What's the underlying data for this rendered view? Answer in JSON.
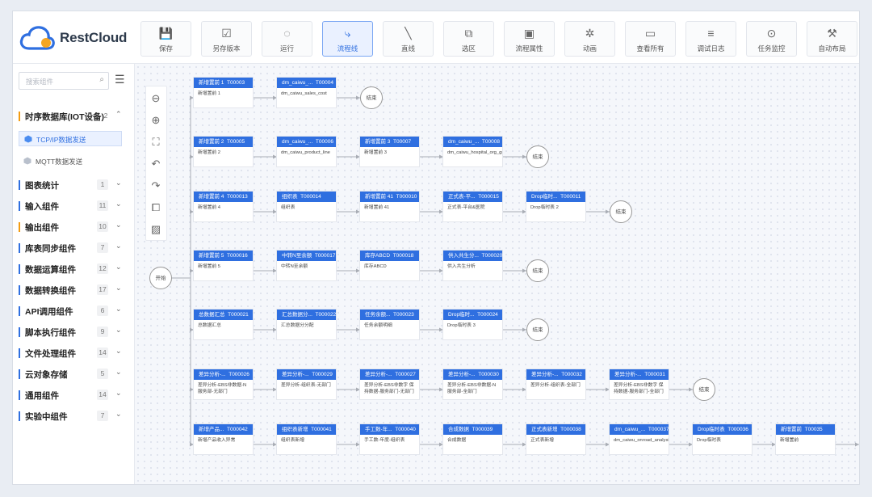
{
  "app": {
    "logo_text": "RestCloud"
  },
  "toolbar": [
    {
      "label": "保存",
      "icon": "💾"
    },
    {
      "label": "另存版本",
      "icon": "☑"
    },
    {
      "label": "运行",
      "icon": "◌"
    },
    {
      "label": "流程线",
      "icon": "⤷",
      "active": true
    },
    {
      "label": "直线",
      "icon": "╲"
    },
    {
      "label": "选区",
      "icon": "⧉"
    },
    {
      "label": "流程属性",
      "icon": "▣"
    },
    {
      "label": "动画",
      "icon": "✲"
    },
    {
      "label": "查看所有",
      "icon": "▭"
    },
    {
      "label": "调试日志",
      "icon": "≡"
    },
    {
      "label": "任务监控",
      "icon": "⊙"
    },
    {
      "label": "自动布局",
      "icon": "⚒"
    }
  ],
  "sidebar": {
    "search_placeholder": "搜索组件",
    "groups": [
      {
        "label": "时序数据库(IOT设备)",
        "count": "2",
        "chev": "⌃",
        "warn": true
      },
      {
        "label": "图表统计",
        "count": "1",
        "chev": "⌄"
      },
      {
        "label": "输入组件",
        "count": "11",
        "chev": "⌄"
      },
      {
        "label": "输出组件",
        "count": "10",
        "chev": "⌄",
        "warn": true
      },
      {
        "label": "库表同步组件",
        "count": "7",
        "chev": "⌄"
      },
      {
        "label": "数据运算组件",
        "count": "12",
        "chev": "⌄"
      },
      {
        "label": "数据转换组件",
        "count": "17",
        "chev": "⌄"
      },
      {
        "label": "API调用组件",
        "count": "6",
        "chev": "⌄"
      },
      {
        "label": "脚本执行组件",
        "count": "9",
        "chev": "⌄"
      },
      {
        "label": "文件处理组件",
        "count": "14",
        "chev": "⌄"
      },
      {
        "label": "云对象存储",
        "count": "5",
        "chev": "⌄"
      },
      {
        "label": "通用组件",
        "count": "14",
        "chev": "⌄"
      },
      {
        "label": "实验中组件",
        "count": "7",
        "chev": "⌄"
      }
    ],
    "sub_items": [
      {
        "label": "TCP/IP数据发送",
        "active": true
      },
      {
        "label": "MQTT数据发送",
        "active": false
      }
    ]
  },
  "canvas_tools": [
    "zoom-out",
    "zoom-in",
    "fit-view",
    "undo",
    "redo",
    "fullscreen",
    "grid"
  ],
  "flow": {
    "start_label": "开始",
    "end_label": "结束",
    "rows": [
      {
        "nodes": [
          {
            "t": "新增置前 1",
            "id": "T00003",
            "b": "新增置前 1"
          },
          {
            "t": "dm_caiwu_...",
            "id": "T00004",
            "b": "dm_caiwu_sales_cost"
          }
        ]
      },
      {
        "nodes": [
          {
            "t": "新增置前 2",
            "id": "T00005",
            "b": "新增置前 2"
          },
          {
            "t": "dm_caiwu_...",
            "id": "T00006",
            "b": "dm_caiwu_product_line"
          },
          {
            "t": "新增置前 3",
            "id": "T00007",
            "b": "新增置前 3"
          },
          {
            "t": "dm_caiwu_...",
            "id": "T00008",
            "b": "dm_caiwu_hospital_org_gnp"
          }
        ]
      },
      {
        "nodes": [
          {
            "t": "新增置前 4",
            "id": "T000013",
            "b": "新增置前 4"
          },
          {
            "t": "组织表",
            "id": "T000014",
            "b": "组织表"
          },
          {
            "t": "新增置前 41",
            "id": "T000010",
            "b": "新增置前 41"
          },
          {
            "t": "正式表-平...",
            "id": "T000015",
            "b": "正式表-平台&医院"
          },
          {
            "t": "Drop临时...",
            "id": "T000011",
            "b": "Drop临时表 2"
          }
        ]
      },
      {
        "nodes": [
          {
            "t": "新增置前 5",
            "id": "T000016",
            "b": "新增置前 5"
          },
          {
            "t": "中转N至余额",
            "id": "T000017",
            "b": "中转N至余额"
          },
          {
            "t": "库存ABCD",
            "id": "T000018",
            "b": "库存ABCD"
          },
          {
            "t": "供入共生分...",
            "id": "T000020",
            "b": "供入共生分析"
          }
        ]
      },
      {
        "nodes": [
          {
            "t": "总数据汇总",
            "id": "T000021",
            "b": "总数据汇总"
          },
          {
            "t": "汇总数据分...",
            "id": "T000022",
            "b": "汇总数据分分配"
          },
          {
            "t": "任务余额...",
            "id": "T000023",
            "b": "任务余额明细"
          },
          {
            "t": "Drop临时...",
            "id": "T000024",
            "b": "Drop临时表 3"
          }
        ]
      },
      {
        "nodes": [
          {
            "t": "差异分析-...",
            "id": "T000026",
            "b": "差异分析-EBS非数据-N 服务部-无部门"
          },
          {
            "t": "差异分析-...",
            "id": "T000029",
            "b": "差异分析-组织表-无部门"
          },
          {
            "t": "差异分析-...",
            "id": "T000027",
            "b": "差异分析-EBS非数字 保持数据-服务部门-无部门"
          },
          {
            "t": "差异分析-...",
            "id": "T000030",
            "b": "差异分析-EBS非数据-N 服务部-全部门"
          },
          {
            "t": "差异分析-...",
            "id": "T000032",
            "b": "差异分析-组织表-全部门"
          },
          {
            "t": "差异分析-...",
            "id": "T000031",
            "b": "差异分析-EBS非数字 保持数据-服务部门-全部门"
          }
        ]
      },
      {
        "nodes": [
          {
            "t": "新增产品...",
            "id": "T000042",
            "b": "新增产品收入异常"
          },
          {
            "t": "组织表新增",
            "id": "T000041",
            "b": "组织表新增"
          },
          {
            "t": "手工数-年...",
            "id": "T000040",
            "b": "手工数-年度-组织表"
          },
          {
            "t": "合成数据",
            "id": "T000039",
            "b": "合成数据"
          },
          {
            "t": "正式表新增",
            "id": "T000038",
            "b": "正式表新增"
          },
          {
            "t": "dm_caiwu_...",
            "id": "T000037",
            "b": "dm_caiwu_onroad_analysis"
          },
          {
            "t": "Drop临时表",
            "id": "T000036",
            "b": "Drop临时表"
          },
          {
            "t": "新增置前",
            "id": "T00035",
            "b": "新增置前"
          }
        ]
      }
    ]
  }
}
